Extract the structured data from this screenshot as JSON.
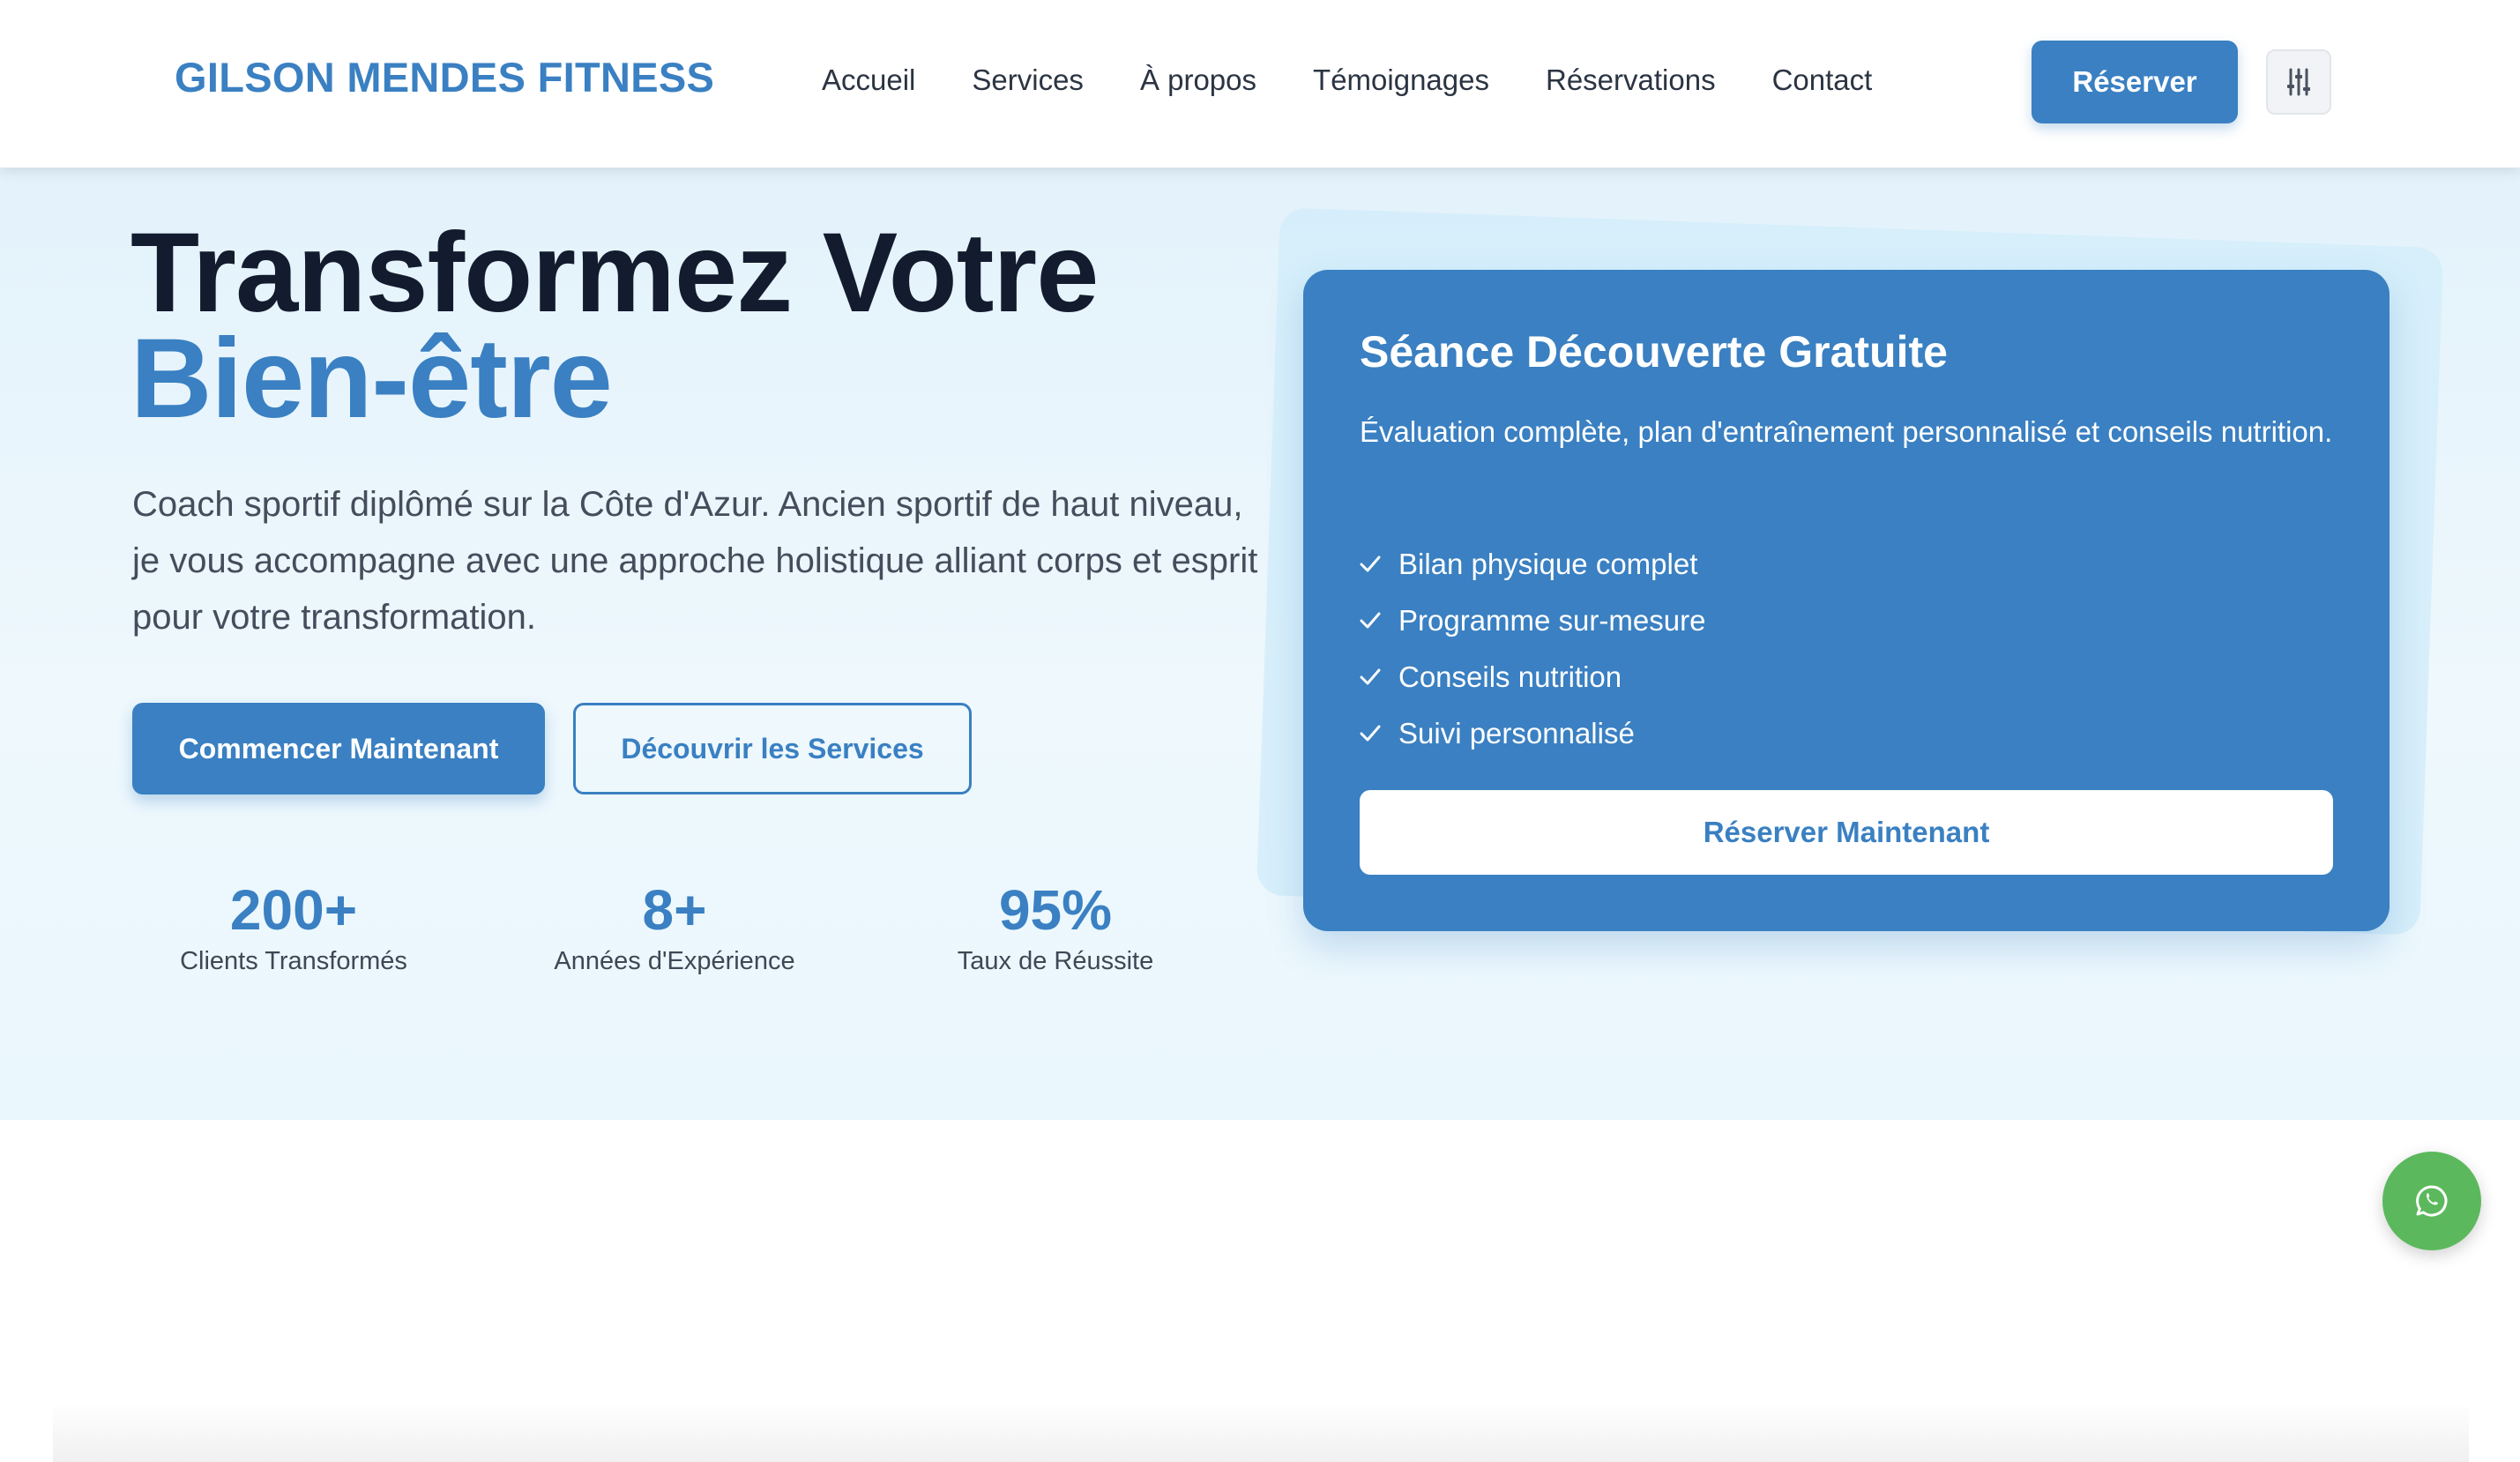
{
  "header": {
    "logo": "GILSON MENDES FITNESS",
    "nav": [
      "Accueil",
      "Services",
      "À propos",
      "Témoignages",
      "Réservations",
      "Contact"
    ],
    "reserve_label": "Réserver",
    "settings_icon": "sliders-icon"
  },
  "hero": {
    "title_line1": "Transformez Votre",
    "title_line2": "Bien-être",
    "description": "Coach sportif diplômé sur la Côte d'Azur. Ancien sportif de haut niveau, je vous accompagne avec une approche holistique alliant corps et esprit pour votre transformation.",
    "primary_button": "Commencer Maintenant",
    "secondary_button": "Découvrir les Services",
    "stats": [
      {
        "value": "200+",
        "label": "Clients Transformés"
      },
      {
        "value": "8+",
        "label": "Années d'Expérience"
      },
      {
        "value": "95%",
        "label": "Taux de Réussite"
      }
    ]
  },
  "card": {
    "title": "Séance Découverte Gratuite",
    "description": "Évaluation complète, plan d'entraînement personnalisé et conseils nutrition.",
    "features": [
      "Bilan physique complet",
      "Programme sur-mesure",
      "Conseils nutrition",
      "Suivi personnalisé"
    ],
    "button": "Réserver Maintenant"
  },
  "floating": {
    "whatsapp_icon": "whatsapp-icon"
  },
  "colors": {
    "accent": "#3a80c2",
    "dark": "#131b2e",
    "hero_bg": "#e8f5fc",
    "whatsapp": "#5cb85c"
  }
}
